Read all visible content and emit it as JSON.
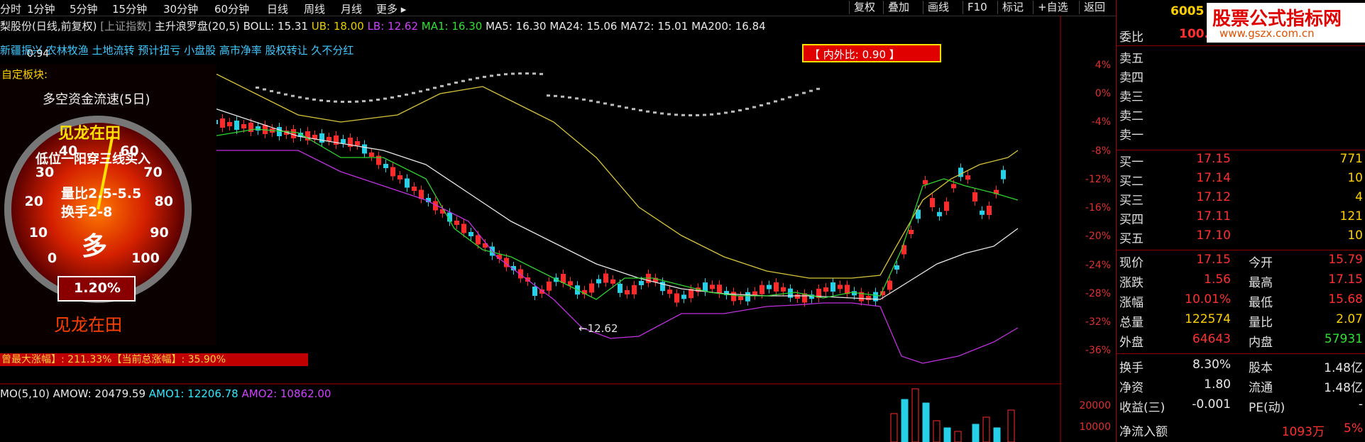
{
  "toolbar": {
    "periods": [
      "分时",
      "1分钟",
      "5分钟",
      "15分钟",
      "30分钟",
      "60分钟",
      "日线",
      "周线",
      "月线",
      "更多 ▸"
    ],
    "buttons": [
      "复权",
      "叠加",
      "画线",
      "F10",
      "标记",
      "+自选",
      "返回"
    ]
  },
  "info": {
    "stock": "梨股份(日线,前复权)",
    "index": "[上证指数]",
    "formula": "主升浪罗盘(20,5)",
    "boll": "BOLL: 15.31",
    "ub": "UB: 18.00",
    "lb": "LB: 12.62",
    "ma1": "MA1: 16.30",
    "ma5": "MA5: 16.30",
    "ma24": "MA24: 15.06",
    "ma72": "MA72: 15.01",
    "ma200": "MA200: 16.84"
  },
  "tags": "新疆振兴  农林牧渔  土地流转  预计扭亏  小盘股  高市净率  股权转让  久不分红",
  "ratio_label": "【 内外比: 0.90 】",
  "low_marker": "←12.62",
  "gauge": {
    "top_value": "0.94",
    "block_label": "自定板块:",
    "title": "多空资金流速(5日)",
    "banner": "见龙在田",
    "line1": "低位一阳穿三线买入",
    "line2": "量比2.5-5.5",
    "line3": "换手2-8",
    "center": "多",
    "percent": "1.20%",
    "bottom": "见龙在田",
    "scale": [
      "0",
      "10",
      "20",
      "30",
      "40",
      "60",
      "70",
      "80",
      "90",
      "100"
    ],
    "needle_value": 54
  },
  "range_bar": "曾最大涨幅】: 211.33%【当前总涨幅】: 35.90%",
  "indicator": {
    "name": "MO(5,10)",
    "amow": "AMOW: 20479.59",
    "amo1": "AMO1: 12206.78",
    "amo2": "AMO2: 10862.00"
  },
  "axis_labels": [
    "4%",
    "0%",
    "-4%",
    "-8%",
    "-12%",
    "-16%",
    "-20%",
    "-24%",
    "-28%",
    "-32%",
    "-36%"
  ],
  "volume_labels": [
    "20000",
    "10000"
  ],
  "colors": {
    "up": "#ff2a2a",
    "down": "#26d0e6",
    "ma_white": "#e8e8e8",
    "ma_yellow": "#d9c43a",
    "ma_green": "#2fd42f",
    "ma_purple": "#c030e0"
  },
  "panel": {
    "code": "6005",
    "weibi_label": "委比",
    "weibi_value": "100.",
    "sells": [
      "卖五",
      "卖四",
      "卖三",
      "卖二",
      "卖一"
    ],
    "buys": [
      {
        "label": "买一",
        "price": "17.15",
        "vol": "771"
      },
      {
        "label": "买二",
        "price": "17.14",
        "vol": "10"
      },
      {
        "label": "买三",
        "price": "17.12",
        "vol": "4"
      },
      {
        "label": "买四",
        "price": "17.11",
        "vol": "121"
      },
      {
        "label": "买五",
        "price": "17.10",
        "vol": "10"
      }
    ],
    "stats": [
      {
        "l1": "现价",
        "v1": "17.15",
        "l2": "今开",
        "v2": "15.79"
      },
      {
        "l1": "涨跌",
        "v1": "1.56",
        "l2": "最高",
        "v2": "17.15"
      },
      {
        "l1": "涨幅",
        "v1": "10.01%",
        "l2": "最低",
        "v2": "15.68"
      },
      {
        "l1": "总量",
        "v1": "122574",
        "l2": "量比",
        "v2": "2.07"
      },
      {
        "l1": "外盘",
        "v1": "64643",
        "l2": "内盘",
        "v2": "57931"
      }
    ],
    "fund": [
      {
        "l1": "换手",
        "v1": "8.30%",
        "l2": "股本",
        "v2": "1.48亿"
      },
      {
        "l1": "净资",
        "v1": "1.80",
        "l2": "流通",
        "v2": "1.48亿"
      },
      {
        "l1": "收益(三)",
        "v1": "-0.001",
        "l2": "PE(动)",
        "v2": "-"
      }
    ],
    "netflow_label": "净流入额",
    "netflow_value": "1093万",
    "netflow_pct": "5%"
  },
  "logo": {
    "line1": "股票公式指标网",
    "line2": "www.gszx.com.cn"
  }
}
